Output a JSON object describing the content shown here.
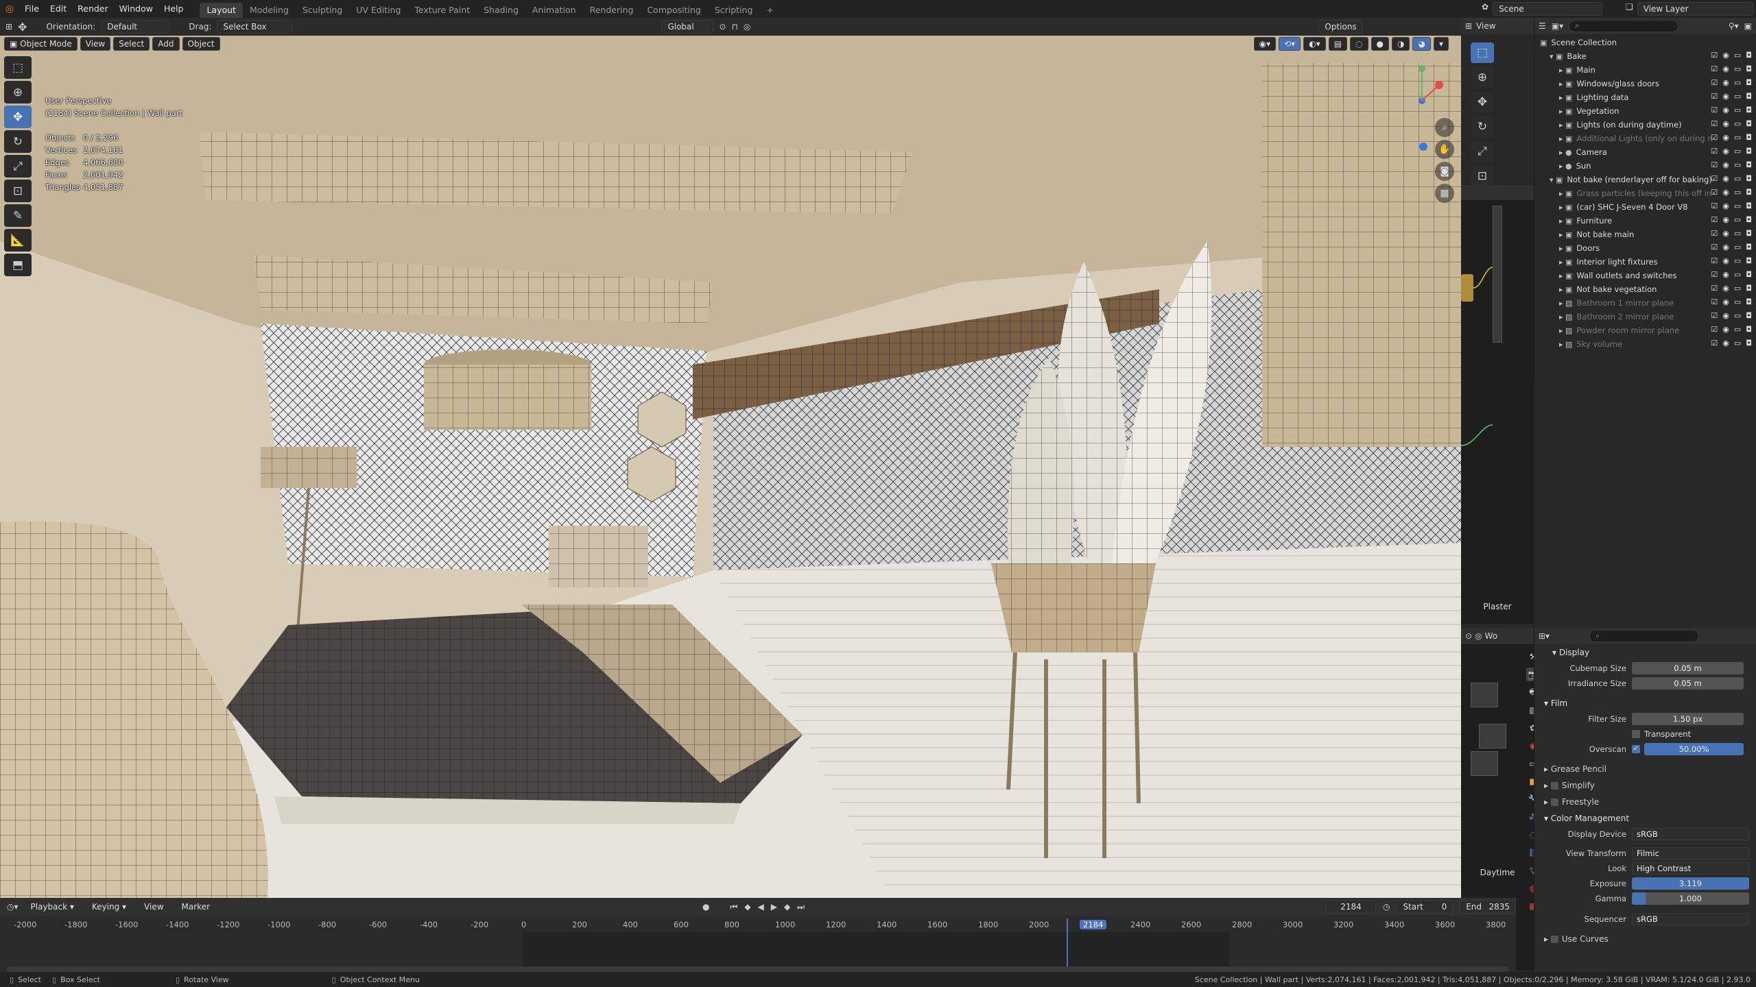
{
  "app": {
    "menus": [
      "File",
      "Edit",
      "Render",
      "Window",
      "Help"
    ],
    "workspaces": [
      "Layout",
      "Modeling",
      "Sculpting",
      "UV Editing",
      "Texture Paint",
      "Shading",
      "Animation",
      "Rendering",
      "Compositing",
      "Scripting"
    ],
    "active_workspace": "Layout",
    "add_workspace": "+",
    "scene_label": "Scene",
    "view_layer_label": "View Layer"
  },
  "tool_header": {
    "orientation_label": "Orientation:",
    "orientation_value": "Default",
    "drag_label": "Drag:",
    "drag_value": "Select Box",
    "transform_orientation": "Global",
    "options_label": "Options"
  },
  "viewport_header": {
    "mode": "Object Mode",
    "menus": [
      "View",
      "Select",
      "Add",
      "Object"
    ]
  },
  "viewport": {
    "perspective": "User Perspective",
    "context": "(2184) Scene Collection | Wall part",
    "stats": [
      {
        "key": "Objects",
        "value": "0 / 2,296"
      },
      {
        "key": "Vertices",
        "value": "2,074,161"
      },
      {
        "key": "Edges",
        "value": "4,066,680"
      },
      {
        "key": "Faces",
        "value": "2,001,942"
      },
      {
        "key": "Triangles",
        "value": "4,051,887"
      }
    ]
  },
  "outliner": {
    "root": "Scene Collection",
    "rows": [
      {
        "label": "Bake",
        "indent": 1,
        "icon": "▾ ▣",
        "dim": false
      },
      {
        "label": "Main",
        "indent": 2,
        "icon": "▸ ▣",
        "dim": false
      },
      {
        "label": "Windows/glass doors",
        "indent": 2,
        "icon": "▸ ▣",
        "dim": false
      },
      {
        "label": "Lighting data",
        "indent": 2,
        "icon": "▸ ▣",
        "dim": false
      },
      {
        "label": "Vegetation",
        "indent": 2,
        "icon": "▸ ▣",
        "dim": false
      },
      {
        "label": "Lights (on during daytime)",
        "indent": 2,
        "icon": "▸ ▣",
        "dim": false
      },
      {
        "label": "Additional Lights (only on during n",
        "indent": 2,
        "icon": "▸ ▣",
        "dim": true
      },
      {
        "label": "Camera",
        "indent": 2,
        "icon": "▸ ●",
        "dim": false
      },
      {
        "label": "Sun",
        "indent": 2,
        "icon": "▸ ●",
        "dim": false
      },
      {
        "label": "Not bake (renderlayer off for baking)",
        "indent": 1,
        "icon": "▾ ▣",
        "dim": false
      },
      {
        "label": "Grass particles (keeping this off in",
        "indent": 2,
        "icon": "▸ ▣",
        "dim": true
      },
      {
        "label": "(car) SHC J-Seven 4 Door V8",
        "indent": 2,
        "icon": "▸ ▣",
        "dim": false
      },
      {
        "label": "Furniture",
        "indent": 2,
        "icon": "▸ ▣",
        "dim": false
      },
      {
        "label": "Not bake main",
        "indent": 2,
        "icon": "▸ ▣",
        "dim": false
      },
      {
        "label": "Doors",
        "indent": 2,
        "icon": "▸ ▣",
        "dim": false
      },
      {
        "label": "Interior light fixtures",
        "indent": 2,
        "icon": "▸ ▣",
        "dim": false
      },
      {
        "label": "Wall outlets and switches",
        "indent": 2,
        "icon": "▸ ▣",
        "dim": false
      },
      {
        "label": "Not bake vegetation",
        "indent": 2,
        "icon": "▸ ▣",
        "dim": false
      },
      {
        "label": "Bathroom 1 mirror plane",
        "indent": 2,
        "icon": "▸ ▨",
        "dim": true
      },
      {
        "label": "Bathroom 2 mirror plane",
        "indent": 2,
        "icon": "▸ ▨",
        "dim": true
      },
      {
        "label": "Powder room mirror plane",
        "indent": 2,
        "icon": "▸ ▨",
        "dim": true
      },
      {
        "label": "Sky volume",
        "indent": 2,
        "icon": "▸ ▨",
        "dim": true
      }
    ]
  },
  "node_editor": {
    "material_label": "Plaster",
    "world_label": "Daytime",
    "short_label": "Wo"
  },
  "properties": {
    "display_section": "Display",
    "cubemap_label": "Cubemap Size",
    "cubemap_value": "0.05 m",
    "irradiance_label": "Irradiance Size",
    "irradiance_value": "0.05 m",
    "film_section": "Film",
    "filter_label": "Filter Size",
    "filter_value": "1.50 px",
    "transparent_label": "Transparent",
    "overscan_label": "Overscan",
    "overscan_value": "50.00%",
    "overscan_fill": 1.0,
    "grease_pencil": "Grease Pencil",
    "simplify": "Simplify",
    "freestyle": "Freestyle",
    "color_mgmt": "Color Management",
    "display_device_label": "Display Device",
    "display_device_value": "sRGB",
    "view_transform_label": "View Transform",
    "view_transform_value": "Filmic",
    "look_label": "Look",
    "look_value": "High Contrast",
    "exposure_label": "Exposure",
    "exposure_value": "3.119",
    "gamma_label": "Gamma",
    "gamma_value": "1.000",
    "sequencer_label": "Sequencer",
    "sequencer_value": "sRGB",
    "use_curves": "Use Curves"
  },
  "timeline": {
    "menus": [
      "Playback",
      "Keying",
      "View",
      "Marker"
    ],
    "current_frame": "2184",
    "start_label": "Start",
    "start_value": "0",
    "end_label": "End",
    "end_value": "2835",
    "ruler": [
      "-2000",
      "-1800",
      "-1600",
      "-1400",
      "-1200",
      "-1000",
      "-800",
      "-600",
      "-400",
      "-200",
      "0",
      "200",
      "400",
      "600",
      "800",
      "1000",
      "1200",
      "1400",
      "1600",
      "1800",
      "2000",
      "2184",
      "2400",
      "2600",
      "2800",
      "3000",
      "3200",
      "3400",
      "3600",
      "3800"
    ]
  },
  "statusbar": {
    "select": "Select",
    "box_select": "Box Select",
    "rotate_view": "Rotate View",
    "context_menu": "Object Context Menu",
    "info": "Scene Collection | Wall part | Verts:2,074,161 | Faces:2,001,942 | Tris:4,051,887 | Objects:0/2,296 | Memory: 3.58 GiB | VRAM: 5.1/24.0 GiB | 2.93.0"
  },
  "colors": {
    "accent": "#4772b3",
    "selected_frame": "#4d74c4",
    "background": "#1d1d1d"
  }
}
